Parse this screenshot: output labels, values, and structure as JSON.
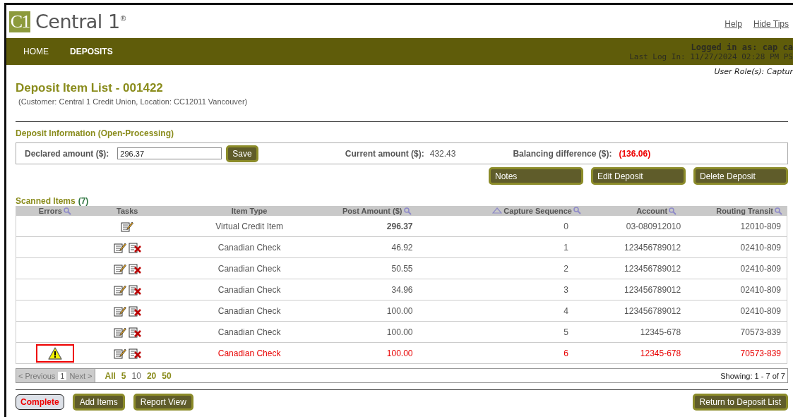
{
  "logo": {
    "mark": "C1",
    "brand": "Central 1",
    "sup": "®"
  },
  "top_links": [
    {
      "label": "Help"
    },
    {
      "label": "Hide Tips"
    }
  ],
  "nav": [
    {
      "label": "HOME",
      "selected": false
    },
    {
      "label": "DEPOSITS",
      "selected": true
    }
  ],
  "user": {
    "logged_in": "Logged in as: cap ca",
    "last_login": "Last Log In: 11/27/2024 02:28 PM PS",
    "roles": "User Role(s): Captur"
  },
  "title": "Deposit Item List - 001422",
  "subtitle": "(Customer: Central 1 Credit Union, Location: CC12011 Vancouver)",
  "deposit_info": {
    "heading": "Deposit Information (Open-Processing)",
    "declared_label": "Declared amount ($):",
    "declared_value": "296.37",
    "save": "Save",
    "current_label": "Current amount ($):",
    "current_value": "432.43",
    "balance_label": "Balancing difference ($):",
    "balance_value": "(136.06)",
    "balance_negative": true
  },
  "actions": [
    "Notes",
    "Edit Deposit",
    "Delete Deposit"
  ],
  "scanned": {
    "heading": "Scanned Items",
    "count": "(7)"
  },
  "table": {
    "columns": [
      {
        "label": "Errors",
        "searchable": true,
        "sorted": false
      },
      {
        "label": "Tasks",
        "searchable": false,
        "sorted": false
      },
      {
        "label": "Item Type",
        "searchable": false,
        "sorted": false
      },
      {
        "label": "Post Amount ($)",
        "searchable": true,
        "sorted": false
      },
      {
        "label": "Capture Sequence",
        "searchable": true,
        "sorted": true
      },
      {
        "label": "Account",
        "searchable": true,
        "sorted": false
      },
      {
        "label": "Routing Transit",
        "searchable": true,
        "sorted": false
      }
    ],
    "rows": [
      {
        "kind": "credit",
        "error": false,
        "deletable": false,
        "item_type": "Virtual Credit Item",
        "amount": "296.37",
        "sequence": "0",
        "account": "03-080912010",
        "routing": "12010-809"
      },
      {
        "kind": "check",
        "error": false,
        "deletable": true,
        "item_type": "Canadian Check",
        "amount": "46.92",
        "sequence": "1",
        "account": "123456789012",
        "routing": "02410-809"
      },
      {
        "kind": "check",
        "error": false,
        "deletable": true,
        "item_type": "Canadian Check",
        "amount": "50.55",
        "sequence": "2",
        "account": "123456789012",
        "routing": "02410-809"
      },
      {
        "kind": "check",
        "error": false,
        "deletable": true,
        "item_type": "Canadian Check",
        "amount": "34.96",
        "sequence": "3",
        "account": "123456789012",
        "routing": "02410-809"
      },
      {
        "kind": "check",
        "error": false,
        "deletable": true,
        "item_type": "Canadian Check",
        "amount": "100.00",
        "sequence": "4",
        "account": "123456789012",
        "routing": "02410-809"
      },
      {
        "kind": "check",
        "error": false,
        "deletable": true,
        "item_type": "Canadian Check",
        "amount": "100.00",
        "sequence": "5",
        "account": "12345-678",
        "routing": "70573-839"
      },
      {
        "kind": "check",
        "error": true,
        "deletable": true,
        "item_type": "Canadian Check",
        "amount": "100.00",
        "sequence": "6",
        "account": "12345-678",
        "routing": "70573-839"
      }
    ]
  },
  "pager": {
    "previous": "< Previous",
    "page": "1",
    "next": "Next >",
    "sizes": [
      {
        "label": "All",
        "selected": false
      },
      {
        "label": "5",
        "selected": false
      },
      {
        "label": "10",
        "selected": true
      },
      {
        "label": "20",
        "selected": false
      },
      {
        "label": "50",
        "selected": false
      }
    ],
    "showing": "Showing: 1 - 7 of 7"
  },
  "bottom_buttons": [
    {
      "label": "Complete",
      "kind": "primary"
    },
    {
      "label": "Add Items",
      "kind": "normal"
    },
    {
      "label": "Report View",
      "kind": "normal"
    }
  ],
  "return_button": "Return to Deposit List"
}
